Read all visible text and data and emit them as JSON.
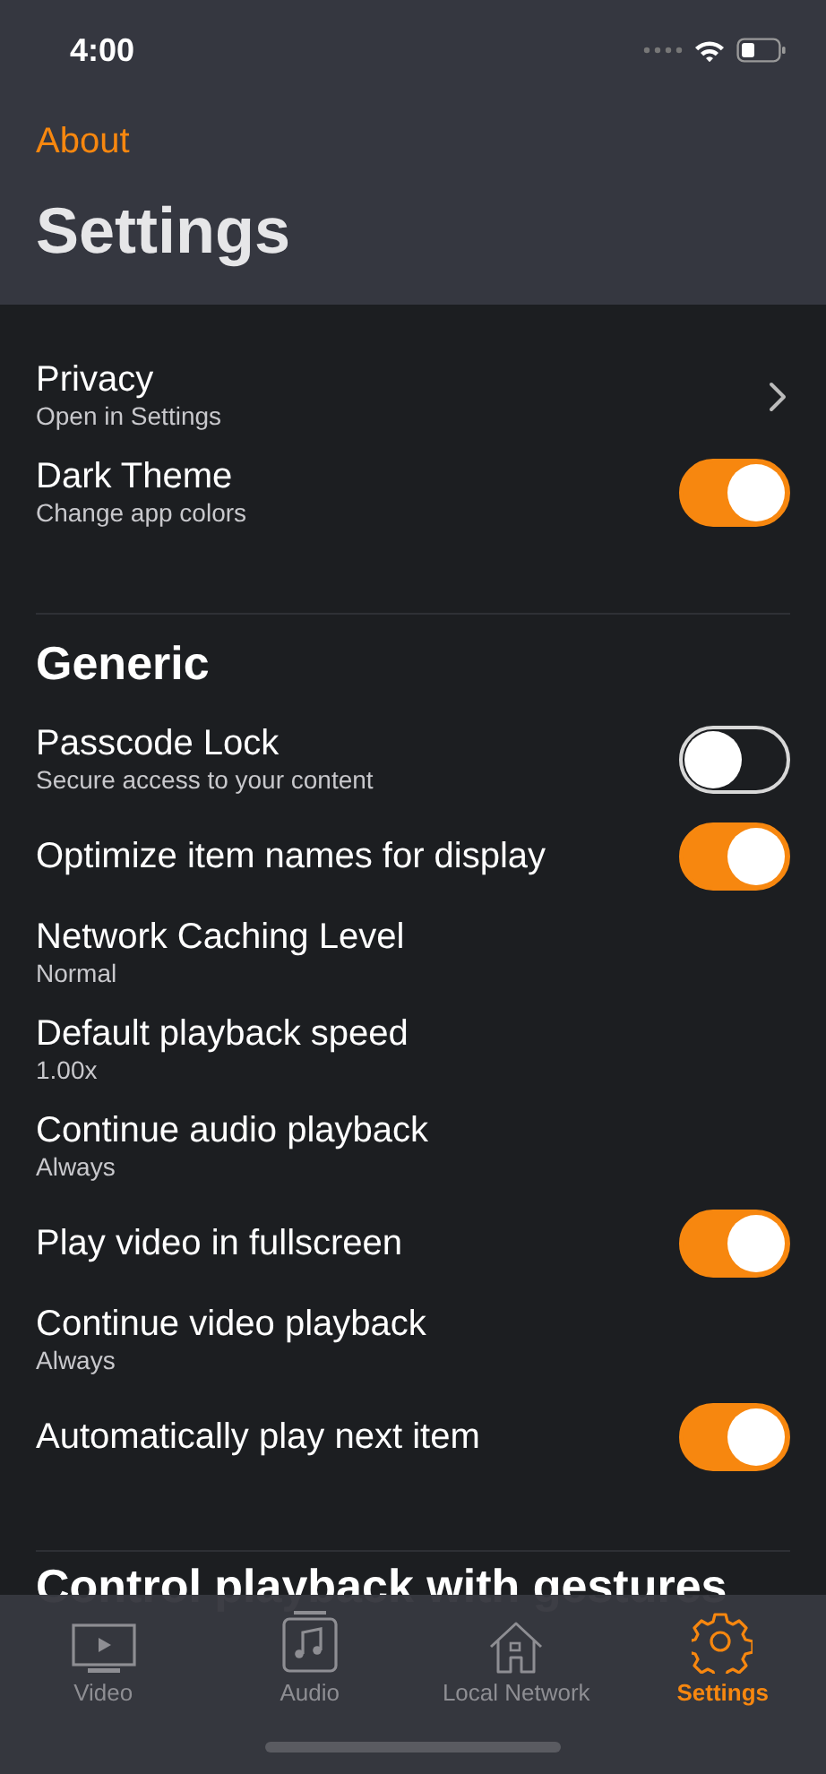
{
  "status_bar": {
    "time": "4:00"
  },
  "nav": {
    "back": "About",
    "title": "Settings"
  },
  "sections": [
    {
      "rows": [
        {
          "kind": "disclosure",
          "title": "Privacy",
          "subtitle": "Open in Settings"
        },
        {
          "kind": "toggle",
          "title": "Dark Theme",
          "subtitle": "Change app colors",
          "on": true
        }
      ]
    },
    {
      "header": "Generic",
      "rows": [
        {
          "kind": "toggle",
          "title": "Passcode Lock",
          "subtitle": "Secure access to your content",
          "on": false
        },
        {
          "kind": "toggle",
          "title": "Optimize item names for display",
          "on": true
        },
        {
          "kind": "detail",
          "title": "Network Caching Level",
          "subtitle": "Normal"
        },
        {
          "kind": "detail",
          "title": "Default playback speed",
          "subtitle": "1.00x"
        },
        {
          "kind": "detail",
          "title": "Continue audio playback",
          "subtitle": "Always"
        },
        {
          "kind": "toggle",
          "title": "Play video in fullscreen",
          "on": true
        },
        {
          "kind": "detail",
          "title": "Continue video playback",
          "subtitle": "Always"
        },
        {
          "kind": "toggle",
          "title": "Automatically play next item",
          "on": true
        }
      ]
    },
    {
      "header": "Control playback with gestures"
    }
  ],
  "tab_bar": [
    {
      "kind": "video",
      "label": "Video",
      "selected": false
    },
    {
      "kind": "audio",
      "label": "Audio",
      "selected": false
    },
    {
      "kind": "network",
      "label": "Local Network",
      "selected": false
    },
    {
      "kind": "settings",
      "label": "Settings",
      "selected": true
    }
  ]
}
